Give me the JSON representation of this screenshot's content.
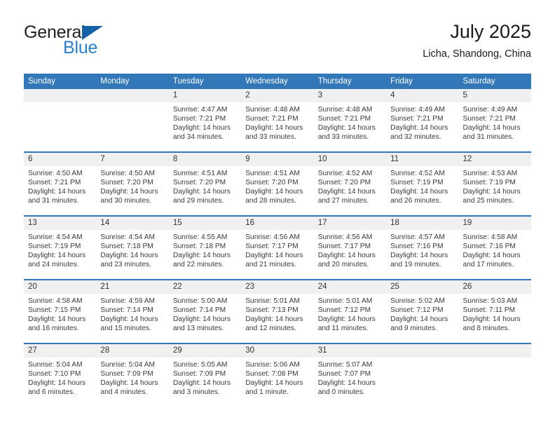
{
  "brand": {
    "name_top": "General",
    "name_bottom": "Blue",
    "triangle_color": "#1461a8",
    "blue_color": "#2a7fd0",
    "dark_color": "#231f20"
  },
  "header": {
    "title": "July 2025",
    "subtitle": "Licha, Shandong, China"
  },
  "theme": {
    "header_bg": "#3278b8",
    "header_text": "#ffffff",
    "daynum_band_bg": "#f0f0f0",
    "row_divider": "#3278b8",
    "cell_bg": "#ffffff"
  },
  "calendar": {
    "weekday_headers": [
      "Sunday",
      "Monday",
      "Tuesday",
      "Wednesday",
      "Thursday",
      "Friday",
      "Saturday"
    ],
    "weeks": [
      [
        {
          "day": "",
          "sunrise": "",
          "sunset": "",
          "daylight_line1": "",
          "daylight_line2": "",
          "empty": true
        },
        {
          "day": "",
          "sunrise": "",
          "sunset": "",
          "daylight_line1": "",
          "daylight_line2": "",
          "empty": true
        },
        {
          "day": "1",
          "sunrise": "Sunrise: 4:47 AM",
          "sunset": "Sunset: 7:21 PM",
          "daylight_line1": "Daylight: 14 hours",
          "daylight_line2": "and 34 minutes."
        },
        {
          "day": "2",
          "sunrise": "Sunrise: 4:48 AM",
          "sunset": "Sunset: 7:21 PM",
          "daylight_line1": "Daylight: 14 hours",
          "daylight_line2": "and 33 minutes."
        },
        {
          "day": "3",
          "sunrise": "Sunrise: 4:48 AM",
          "sunset": "Sunset: 7:21 PM",
          "daylight_line1": "Daylight: 14 hours",
          "daylight_line2": "and 33 minutes."
        },
        {
          "day": "4",
          "sunrise": "Sunrise: 4:49 AM",
          "sunset": "Sunset: 7:21 PM",
          "daylight_line1": "Daylight: 14 hours",
          "daylight_line2": "and 32 minutes."
        },
        {
          "day": "5",
          "sunrise": "Sunrise: 4:49 AM",
          "sunset": "Sunset: 7:21 PM",
          "daylight_line1": "Daylight: 14 hours",
          "daylight_line2": "and 31 minutes."
        }
      ],
      [
        {
          "day": "6",
          "sunrise": "Sunrise: 4:50 AM",
          "sunset": "Sunset: 7:21 PM",
          "daylight_line1": "Daylight: 14 hours",
          "daylight_line2": "and 31 minutes."
        },
        {
          "day": "7",
          "sunrise": "Sunrise: 4:50 AM",
          "sunset": "Sunset: 7:20 PM",
          "daylight_line1": "Daylight: 14 hours",
          "daylight_line2": "and 30 minutes."
        },
        {
          "day": "8",
          "sunrise": "Sunrise: 4:51 AM",
          "sunset": "Sunset: 7:20 PM",
          "daylight_line1": "Daylight: 14 hours",
          "daylight_line2": "and 29 minutes."
        },
        {
          "day": "9",
          "sunrise": "Sunrise: 4:51 AM",
          "sunset": "Sunset: 7:20 PM",
          "daylight_line1": "Daylight: 14 hours",
          "daylight_line2": "and 28 minutes."
        },
        {
          "day": "10",
          "sunrise": "Sunrise: 4:52 AM",
          "sunset": "Sunset: 7:20 PM",
          "daylight_line1": "Daylight: 14 hours",
          "daylight_line2": "and 27 minutes."
        },
        {
          "day": "11",
          "sunrise": "Sunrise: 4:52 AM",
          "sunset": "Sunset: 7:19 PM",
          "daylight_line1": "Daylight: 14 hours",
          "daylight_line2": "and 26 minutes."
        },
        {
          "day": "12",
          "sunrise": "Sunrise: 4:53 AM",
          "sunset": "Sunset: 7:19 PM",
          "daylight_line1": "Daylight: 14 hours",
          "daylight_line2": "and 25 minutes."
        }
      ],
      [
        {
          "day": "13",
          "sunrise": "Sunrise: 4:54 AM",
          "sunset": "Sunset: 7:19 PM",
          "daylight_line1": "Daylight: 14 hours",
          "daylight_line2": "and 24 minutes."
        },
        {
          "day": "14",
          "sunrise": "Sunrise: 4:54 AM",
          "sunset": "Sunset: 7:18 PM",
          "daylight_line1": "Daylight: 14 hours",
          "daylight_line2": "and 23 minutes."
        },
        {
          "day": "15",
          "sunrise": "Sunrise: 4:55 AM",
          "sunset": "Sunset: 7:18 PM",
          "daylight_line1": "Daylight: 14 hours",
          "daylight_line2": "and 22 minutes."
        },
        {
          "day": "16",
          "sunrise": "Sunrise: 4:56 AM",
          "sunset": "Sunset: 7:17 PM",
          "daylight_line1": "Daylight: 14 hours",
          "daylight_line2": "and 21 minutes."
        },
        {
          "day": "17",
          "sunrise": "Sunrise: 4:56 AM",
          "sunset": "Sunset: 7:17 PM",
          "daylight_line1": "Daylight: 14 hours",
          "daylight_line2": "and 20 minutes."
        },
        {
          "day": "18",
          "sunrise": "Sunrise: 4:57 AM",
          "sunset": "Sunset: 7:16 PM",
          "daylight_line1": "Daylight: 14 hours",
          "daylight_line2": "and 19 minutes."
        },
        {
          "day": "19",
          "sunrise": "Sunrise: 4:58 AM",
          "sunset": "Sunset: 7:16 PM",
          "daylight_line1": "Daylight: 14 hours",
          "daylight_line2": "and 17 minutes."
        }
      ],
      [
        {
          "day": "20",
          "sunrise": "Sunrise: 4:58 AM",
          "sunset": "Sunset: 7:15 PM",
          "daylight_line1": "Daylight: 14 hours",
          "daylight_line2": "and 16 minutes."
        },
        {
          "day": "21",
          "sunrise": "Sunrise: 4:59 AM",
          "sunset": "Sunset: 7:14 PM",
          "daylight_line1": "Daylight: 14 hours",
          "daylight_line2": "and 15 minutes."
        },
        {
          "day": "22",
          "sunrise": "Sunrise: 5:00 AM",
          "sunset": "Sunset: 7:14 PM",
          "daylight_line1": "Daylight: 14 hours",
          "daylight_line2": "and 13 minutes."
        },
        {
          "day": "23",
          "sunrise": "Sunrise: 5:01 AM",
          "sunset": "Sunset: 7:13 PM",
          "daylight_line1": "Daylight: 14 hours",
          "daylight_line2": "and 12 minutes."
        },
        {
          "day": "24",
          "sunrise": "Sunrise: 5:01 AM",
          "sunset": "Sunset: 7:12 PM",
          "daylight_line1": "Daylight: 14 hours",
          "daylight_line2": "and 11 minutes."
        },
        {
          "day": "25",
          "sunrise": "Sunrise: 5:02 AM",
          "sunset": "Sunset: 7:12 PM",
          "daylight_line1": "Daylight: 14 hours",
          "daylight_line2": "and 9 minutes."
        },
        {
          "day": "26",
          "sunrise": "Sunrise: 5:03 AM",
          "sunset": "Sunset: 7:11 PM",
          "daylight_line1": "Daylight: 14 hours",
          "daylight_line2": "and 8 minutes."
        }
      ],
      [
        {
          "day": "27",
          "sunrise": "Sunrise: 5:04 AM",
          "sunset": "Sunset: 7:10 PM",
          "daylight_line1": "Daylight: 14 hours",
          "daylight_line2": "and 6 minutes."
        },
        {
          "day": "28",
          "sunrise": "Sunrise: 5:04 AM",
          "sunset": "Sunset: 7:09 PM",
          "daylight_line1": "Daylight: 14 hours",
          "daylight_line2": "and 4 minutes."
        },
        {
          "day": "29",
          "sunrise": "Sunrise: 5:05 AM",
          "sunset": "Sunset: 7:09 PM",
          "daylight_line1": "Daylight: 14 hours",
          "daylight_line2": "and 3 minutes."
        },
        {
          "day": "30",
          "sunrise": "Sunrise: 5:06 AM",
          "sunset": "Sunset: 7:08 PM",
          "daylight_line1": "Daylight: 14 hours",
          "daylight_line2": "and 1 minute."
        },
        {
          "day": "31",
          "sunrise": "Sunrise: 5:07 AM",
          "sunset": "Sunset: 7:07 PM",
          "daylight_line1": "Daylight: 14 hours",
          "daylight_line2": "and 0 minutes."
        },
        {
          "day": "",
          "sunrise": "",
          "sunset": "",
          "daylight_line1": "",
          "daylight_line2": "",
          "empty": true
        },
        {
          "day": "",
          "sunrise": "",
          "sunset": "",
          "daylight_line1": "",
          "daylight_line2": "",
          "empty": true
        }
      ]
    ]
  }
}
